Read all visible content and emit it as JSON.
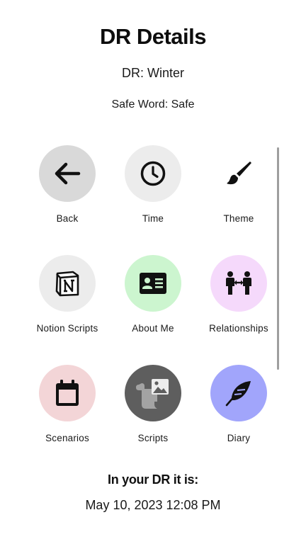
{
  "header": {
    "title": "DR Details",
    "dr_line": "DR: Winter",
    "safe_word_line": "Safe Word: Safe"
  },
  "tiles": [
    {
      "label": "Back",
      "icon": "arrow-left-icon",
      "bg": "#d9d9d9"
    },
    {
      "label": "Time",
      "icon": "clock-icon",
      "bg": "#ececec"
    },
    {
      "label": "Theme",
      "icon": "paintbrush-icon",
      "bg": "#ffffff"
    },
    {
      "label": "Notion Scripts",
      "icon": "notion-icon",
      "bg": "#ececec"
    },
    {
      "label": "About Me",
      "icon": "id-card-icon",
      "bg": "#ccf5cf"
    },
    {
      "label": "Relationships",
      "icon": "people-arrows-icon",
      "bg": "#f5d9fb"
    },
    {
      "label": "Scenarios",
      "icon": "calendar-icon",
      "bg": "#f3d5d7"
    },
    {
      "label": "Scripts",
      "icon": "scroll-image-icon",
      "bg": "#5e5e5e"
    },
    {
      "label": "Diary",
      "icon": "feather-icon",
      "bg": "#a1a5fb"
    }
  ],
  "footer": {
    "heading": "In your DR it is:",
    "datetime": "May 10, 2023 12:08 PM"
  }
}
